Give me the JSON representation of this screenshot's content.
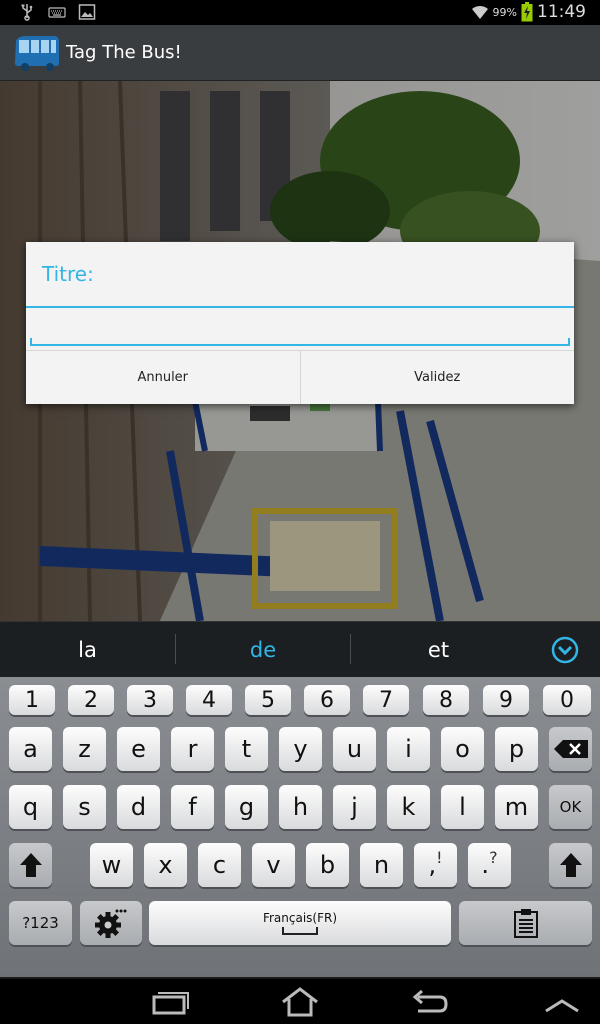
{
  "status_bar": {
    "battery_percent": "99%",
    "time": "11:49",
    "icons": [
      "usb-icon",
      "keyboard-icon",
      "image-icon",
      "wifi-icon",
      "battery-charging-icon"
    ]
  },
  "action_bar": {
    "title": "Tag The Bus!",
    "logo_icon": "bus-icon"
  },
  "dialog": {
    "title": "Titre:",
    "input_value": "",
    "buttons": {
      "cancel": "Annuler",
      "confirm": "Validez"
    }
  },
  "keyboard": {
    "suggestions": [
      "la",
      "de",
      "et"
    ],
    "active_suggestion_index": 1,
    "number_row": [
      "1",
      "2",
      "3",
      "4",
      "5",
      "6",
      "7",
      "8",
      "9",
      "0"
    ],
    "row1": [
      "a",
      "z",
      "e",
      "r",
      "t",
      "y",
      "u",
      "i",
      "o",
      "p"
    ],
    "row2": [
      "q",
      "s",
      "d",
      "f",
      "g",
      "h",
      "j",
      "k",
      "l",
      "m"
    ],
    "row3": [
      "w",
      "x",
      "c",
      "v",
      "b",
      "n"
    ],
    "punct_keys": [
      {
        "main": ",",
        "alt": "!"
      },
      {
        "main": ".",
        "alt": "?"
      }
    ],
    "ok_label": "OK",
    "sym_label": "?123",
    "space_label": "Français(FR)"
  },
  "colors": {
    "accent": "#33b5e5"
  }
}
